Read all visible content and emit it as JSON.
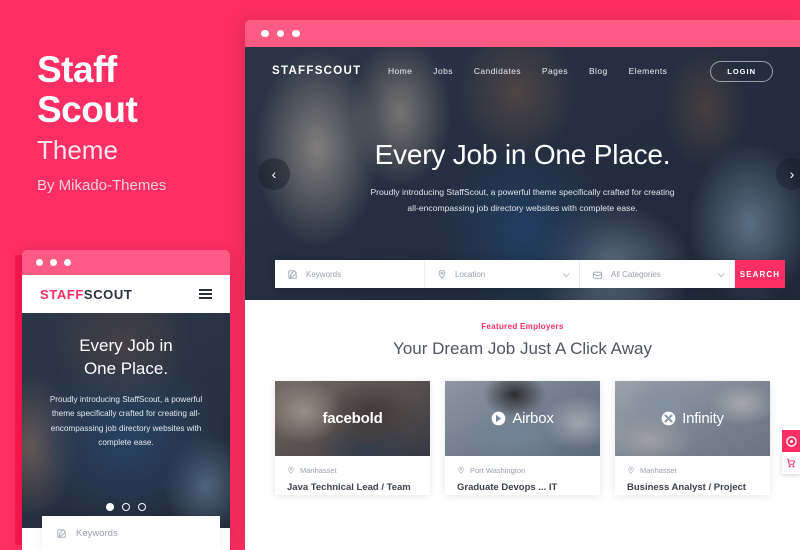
{
  "promo": {
    "title_line1": "Staff",
    "title_line2": "Scout",
    "subtitle": "Theme",
    "byline": "By Mikado-Themes"
  },
  "mobile": {
    "logo_first": "STAFF",
    "logo_second": "SCOUT",
    "menu_icon": "hamburger-icon",
    "hero": {
      "headline_line1": "Every Job in",
      "headline_line2": "One Place.",
      "paragraph": "Proudly introducing StaffScout, a powerful theme specifically crafted for creating all-encompassing job directory websites with complete ease.",
      "slider_dots": 3,
      "active_dot": 1
    },
    "search": {
      "keywords_placeholder": "Keywords",
      "keywords_icon": "edit-pencil-icon"
    }
  },
  "browser": {
    "logo": "STAFFSCOUT",
    "nav": [
      {
        "label": "Home"
      },
      {
        "label": "Jobs"
      },
      {
        "label": "Candidates"
      },
      {
        "label": "Pages"
      },
      {
        "label": "Blog"
      },
      {
        "label": "Elements"
      }
    ],
    "login_label": "LOGIN",
    "hero": {
      "headline": "Every Job in One Place.",
      "paragraph": "Proudly introducing StaffScout, a powerful theme specifically crafted for creating all-encompassing job directory websites with complete ease.",
      "prev_icon": "chevron-left-icon",
      "next_icon": "chevron-right-icon"
    },
    "search": {
      "keywords_placeholder": "Keywords",
      "keywords_icon": "edit-pencil-icon",
      "location_placeholder": "Location",
      "location_icon": "map-pin-icon",
      "category_placeholder": "All Categories",
      "category_icon": "briefcase-icon",
      "submit_label": "SEARCH"
    },
    "featured": {
      "eyebrow": "Featured Employers",
      "title": "Your Dream Job Just A Click Away",
      "cards": [
        {
          "brand": "facebold",
          "location": "Manhasset",
          "job_title": "Java Technical Lead / Team",
          "location_icon": "map-pin-icon"
        },
        {
          "brand": "Airbox",
          "location": "Port Washington",
          "job_title": "Graduate Devops ... IT",
          "location_icon": "map-pin-icon"
        },
        {
          "brand": "Infinity",
          "location": "Manhasset",
          "job_title": "Business Analyst / Project",
          "location_icon": "map-pin-icon"
        }
      ]
    }
  },
  "side_widgets": [
    {
      "icon": "settings-circle-icon",
      "style": "pink"
    },
    {
      "icon": "shopping-cart-icon",
      "style": "white"
    }
  ],
  "colors": {
    "brand_pink": "#fd2e63",
    "chrome_pink": "#fd5b84",
    "dark_text": "#2b2f3a"
  }
}
